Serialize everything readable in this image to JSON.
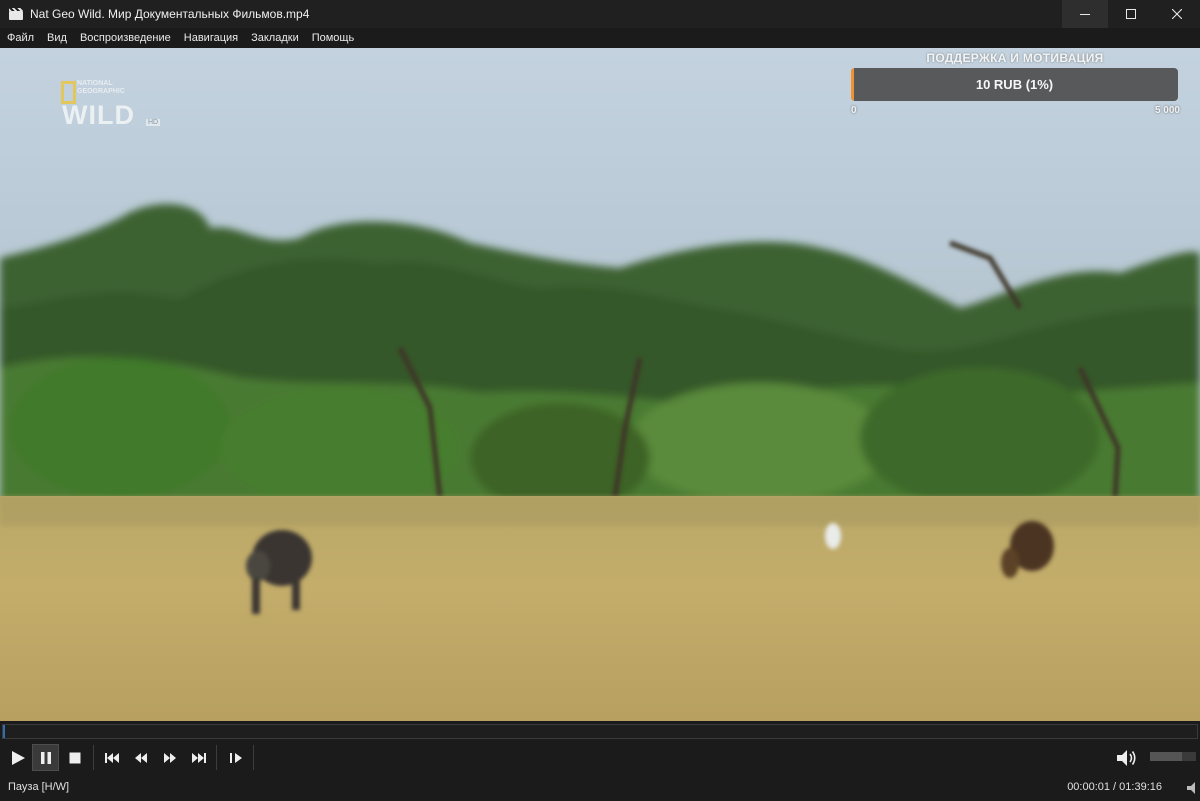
{
  "window": {
    "title": "Nat Geo Wild. Мир Документальных Фильмов.mp4",
    "controls": [
      "minimize-icon",
      "maximize-icon",
      "close-icon"
    ]
  },
  "menu": {
    "items": [
      "Файл",
      "Вид",
      "Воспроизведение",
      "Навигация",
      "Закладки",
      "Помощь"
    ]
  },
  "overlay": {
    "logo": {
      "line1": "NATIONAL",
      "line2": "GEOGRAPHIC",
      "wordmark": "WILD",
      "badge": "HD"
    },
    "donation": {
      "title": "ПОДДЕРЖКА И МОТИВАЦИЯ",
      "amount_label": "10 RUB (1%)",
      "progress_fraction": 0.01,
      "min_label": "0",
      "max_label": "5 000",
      "fill_color": "#f0922d"
    }
  },
  "playback": {
    "seek_fraction": 0.0002,
    "volume_fraction": 0.7,
    "buttons": [
      "play-icon",
      "pause-icon",
      "stop-icon",
      "skip-previous-icon",
      "rewind-icon",
      "fast-forward-icon",
      "skip-next-icon",
      "frame-step-icon"
    ],
    "active_button": "pause-button",
    "accent_color": "#2f6eb0"
  },
  "status": {
    "state": "Пауза [H/W]",
    "time": "00:00:01 / 01:39:16"
  }
}
